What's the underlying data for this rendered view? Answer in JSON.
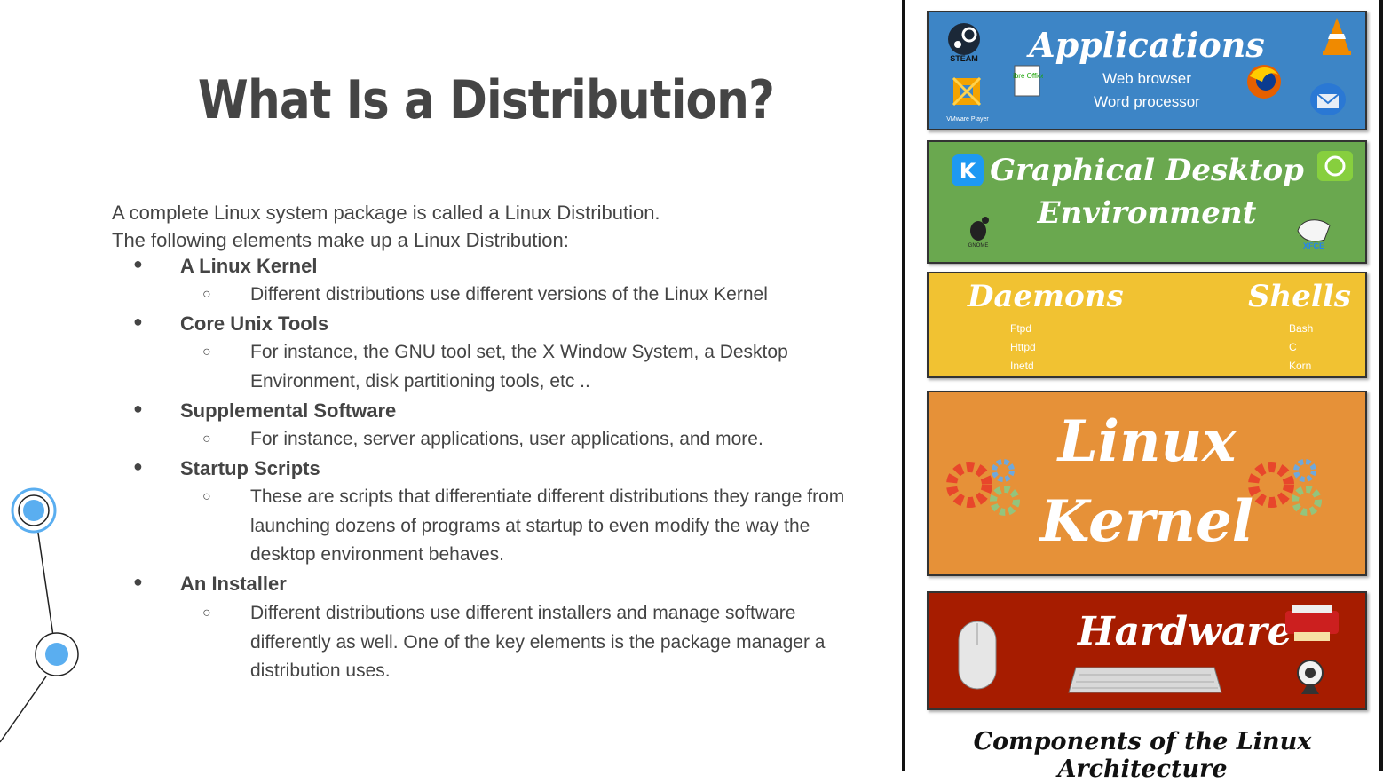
{
  "title": "What Is a Distribution?",
  "intro": [
    "A complete Linux system package is called a Linux Distribution.",
    "The following elements make up a Linux Distribution:"
  ],
  "bullet_glyph": "●",
  "sub_glyph": "○",
  "items": [
    {
      "label": "A Linux Kernel",
      "sub": "Different distributions use different versions of the Linux Kernel"
    },
    {
      "label": "Core Unix Tools",
      "sub": [
        "For instance, the GNU tool set, the X Window System, a Desktop",
        "Environment, disk partitioning tools, etc .."
      ]
    },
    {
      "label": "Supplemental Software",
      "sub": "For instance, server applications, user applications, and more."
    },
    {
      "label": "Startup Scripts",
      "sub": [
        "These are scripts that differentiate different distributions they range from",
        "launching dozens of programs at startup to even modify the way the",
        "desktop environment behaves."
      ]
    },
    {
      "label": "An Installer",
      "sub": [
        "Different distributions use different installers and manage software",
        "differently as well. One of the key elements is the package manager a",
        "distribution uses."
      ]
    }
  ],
  "diagram": {
    "applications": {
      "title": "Applications",
      "lines": [
        "Web browser",
        "Word processor"
      ],
      "icons": [
        "steam-icon",
        "vlc-icon",
        "libreoffice-icon",
        "firefox-icon",
        "vmware-icon",
        "thunderbird-icon"
      ],
      "icon_labels": {
        "steam": "STEAM",
        "libreoffice": "Libre Office",
        "vmware": "VMware Player"
      }
    },
    "desktop": {
      "title_lines": [
        "Graphical Desktop",
        "Environment"
      ],
      "icons": [
        "kde-icon",
        "mint-icon",
        "gnome-icon",
        "xfce-icon"
      ],
      "icon_labels": {
        "gnome": "GNOME",
        "xfce": "XFCE"
      }
    },
    "daemons": {
      "title": "Daemons",
      "items": [
        "Ftpd",
        "Httpd",
        "Inetd"
      ]
    },
    "shells": {
      "title": "Shells",
      "items": [
        "Bash",
        "C",
        "Korn"
      ]
    },
    "kernel": {
      "title_lines": [
        "Linux",
        "Kernel"
      ],
      "icons": [
        "gears-icon"
      ]
    },
    "hardware": {
      "title": "Hardware",
      "icons": [
        "mouse-icon",
        "keyboard-icon",
        "printer-icon",
        "webcam-icon"
      ]
    },
    "caption": "Components of the Linux Architecture"
  },
  "colors": {
    "applications": "#3d85c6",
    "desktop": "#6aa84f",
    "daemons_shells": "#f1c232",
    "kernel": "#e69138",
    "hardware": "#a61c00",
    "node_accent": "#5aaef0"
  }
}
